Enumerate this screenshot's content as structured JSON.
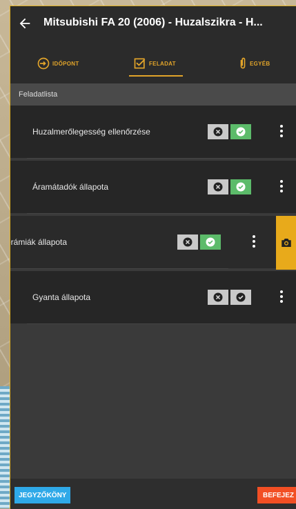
{
  "header": {
    "title": "Mitsubishi FA 20 (2006) - Huzalszikra - H..."
  },
  "tabs": [
    {
      "label": "IDŐPONT",
      "icon": "clock-arrow-icon"
    },
    {
      "label": "FELADAT",
      "icon": "checkbox-icon",
      "active": true
    },
    {
      "label": "EGYÉB",
      "icon": "paperclip-icon"
    }
  ],
  "section": {
    "title": "Feladatlista"
  },
  "tasks": [
    {
      "label": "Huzalmerőlegesség ellenőrzése",
      "status": "approved"
    },
    {
      "label": "Áramátadók állapota",
      "status": "approved"
    },
    {
      "label": "erámiák állapota",
      "status": "approved",
      "swiped": true
    },
    {
      "label": "Gyanta állapota",
      "status": "neutral"
    }
  ],
  "footer": {
    "notes_label": "JEGYZŐKÖNY",
    "finish_label": "BEFEJEZ"
  },
  "colors": {
    "accent": "#e3a52a",
    "approve": "#5cbb6a",
    "notes": "#2fa9e8",
    "finish": "#f24f24"
  }
}
